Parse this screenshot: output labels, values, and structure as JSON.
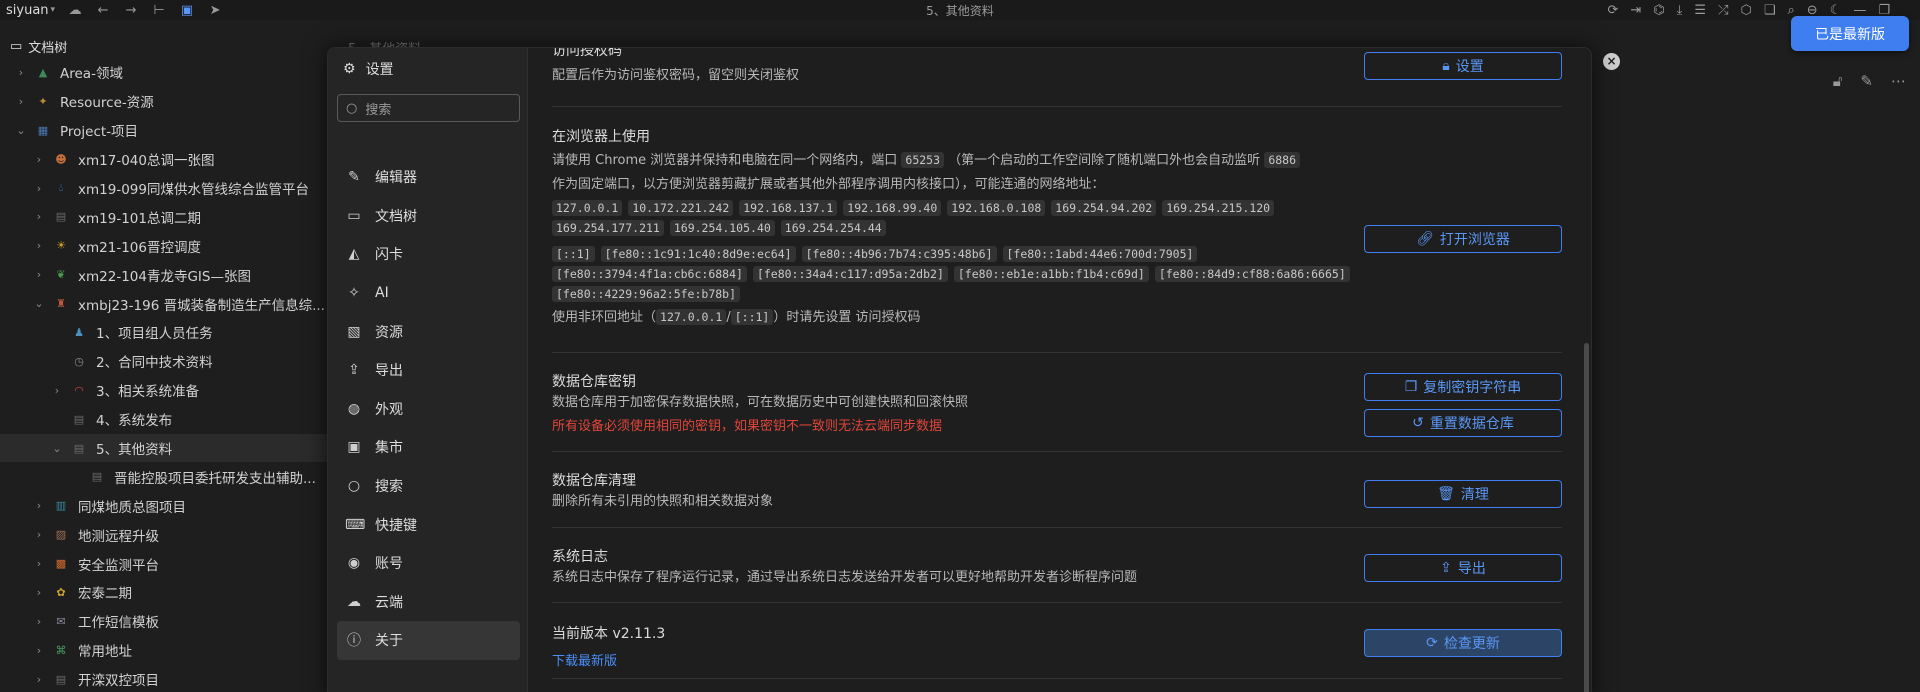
{
  "topbar": {
    "user": "siyuan",
    "title": "5、其他资料",
    "latest_button": "已是最新版"
  },
  "tree": {
    "title": "文档树",
    "items": [
      {
        "label": "Area-领域",
        "level": 0,
        "expand": "closed",
        "icon": "area-icon"
      },
      {
        "label": "Resource-资源",
        "level": 0,
        "expand": "closed",
        "icon": "resource-icon"
      },
      {
        "label": "Project-项目",
        "level": 0,
        "expand": "open",
        "icon": "calendar-icon"
      },
      {
        "label": "xm17-040总调一张图",
        "level": 1,
        "expand": "closed",
        "icon": "face-icon"
      },
      {
        "label": "xm19-099同煤供水管线综合监管平台",
        "level": 1,
        "expand": "closed",
        "icon": "water-icon"
      },
      {
        "label": "xm19-101总调二期",
        "level": 1,
        "expand": "closed",
        "icon": "doc-icon"
      },
      {
        "label": "xm21-106晋控调度",
        "level": 1,
        "expand": "closed",
        "icon": "sun-face-icon"
      },
      {
        "label": "xm22-104青龙寺GIS—张图",
        "level": 1,
        "expand": "closed",
        "icon": "dragon-icon"
      },
      {
        "label": "xmbj23-196 晋城装备制造生产信息综...",
        "level": 1,
        "expand": "open",
        "icon": "tower-icon"
      },
      {
        "label": "1、项目组人员任务",
        "level": 2,
        "expand": "none",
        "icon": "team-icon"
      },
      {
        "label": "2、合同中技术资料",
        "level": 2,
        "expand": "none",
        "icon": "clock-icon"
      },
      {
        "label": "3、相关系统准备",
        "level": 2,
        "expand": "closed",
        "icon": "rainbow-icon"
      },
      {
        "label": "4、系统发布",
        "level": 2,
        "expand": "none",
        "icon": "doc-icon"
      },
      {
        "label": "5、其他资料",
        "level": 2,
        "expand": "open",
        "icon": "doc-icon",
        "selected": true
      },
      {
        "label": "晋能控股项目委托研发支出辅助...",
        "level": 3,
        "expand": "none",
        "icon": "doc-icon"
      },
      {
        "label": "同煤地质总图项目",
        "level": 1,
        "expand": "closed",
        "icon": "book-icon"
      },
      {
        "label": "地测远程升级",
        "level": 1,
        "expand": "closed",
        "icon": "box-icon"
      },
      {
        "label": "安全监测平台",
        "level": 1,
        "expand": "closed",
        "icon": "vest-icon"
      },
      {
        "label": "宏泰二期",
        "level": 1,
        "expand": "closed",
        "icon": "flower-icon"
      },
      {
        "label": "工作短信模板",
        "level": 1,
        "expand": "closed",
        "icon": "mail-icon"
      },
      {
        "label": "常用地址",
        "level": 1,
        "expand": "closed",
        "icon": "map-icon"
      },
      {
        "label": "开滦双控项目",
        "level": 1,
        "expand": "closed",
        "icon": "doc-icon"
      }
    ]
  },
  "editor": {
    "tab_label": "5、其他资料"
  },
  "settings": {
    "title": "设置",
    "search_placeholder": "搜索",
    "nav": [
      {
        "label": "编辑器",
        "icon": "edit-icon"
      },
      {
        "label": "文档树",
        "icon": "folder-icon"
      },
      {
        "label": "闪卡",
        "icon": "flashcard-icon"
      },
      {
        "label": "AI",
        "icon": "ai-icon"
      },
      {
        "label": "资源",
        "icon": "image-icon"
      },
      {
        "label": "导出",
        "icon": "upload-icon"
      },
      {
        "label": "外观",
        "icon": "palette-icon"
      },
      {
        "label": "集市",
        "icon": "bazaar-icon"
      },
      {
        "label": "搜索",
        "icon": "search-icon"
      },
      {
        "label": "快捷键",
        "icon": "keyboard-icon"
      },
      {
        "label": "账号",
        "icon": "account-icon"
      },
      {
        "label": "云端",
        "icon": "cloud-icon"
      },
      {
        "label": "关于",
        "icon": "info-icon",
        "active": true
      }
    ],
    "sections": {
      "auth": {
        "title": "访问授权码",
        "desc": "配置后作为访问鉴权密码，留空则关闭鉴权",
        "button": "设置"
      },
      "browser": {
        "title": "在浏览器上使用",
        "desc1a": "请使用 Chrome 浏览器并保持和电脑在同一个网络内，端口",
        "port": "65253",
        "desc1b": "（第一个启动的工作空间除了随机端口外也会自动监听",
        "fixed_port": "6886",
        "desc2": "作为固定端口，以方便浏览器剪藏扩展或者其他外部程序调用内核接口），可能连通的网络地址：",
        "ipv4": [
          "127.0.0.1",
          "10.172.221.242",
          "192.168.137.1",
          "192.168.99.40",
          "192.168.0.108",
          "169.254.94.202",
          "169.254.215.120",
          "169.254.177.211",
          "169.254.105.40",
          "169.254.254.44"
        ],
        "ipv6": [
          "[::1]",
          "[fe80::1c91:1c40:8d9e:ec64]",
          "[fe80::4b96:7b74:c395:48b6]",
          "[fe80::1abd:44e6:700d:7905]",
          "[fe80::3794:4f1a:cb6c:6884]",
          "[fe80::34a4:c117:d95a:2db2]",
          "[fe80::eb1e:a1bb:f1b4:c69d]",
          "[fe80::84d9:cf88:6a86:6665]",
          "[fe80::4229:96a2:5fe:b78b]"
        ],
        "note_a": "使用非环回地址（",
        "loopback1": "127.0.0.1",
        "slash": "/",
        "loopback2": "[::1]",
        "note_b": "）时请先设置 访问授权码",
        "button": "打开浏览器"
      },
      "repo_key": {
        "title": "数据仓库密钥",
        "desc": "数据仓库用于加密保存数据快照，可在数据历史中可创建快照和回滚快照",
        "warning": "所有设备必须使用相同的密钥，如果密钥不一致则无法云端同步数据",
        "button_copy": "复制密钥字符串",
        "button_reset": "重置数据仓库"
      },
      "repo_clean": {
        "title": "数据仓库清理",
        "desc": "删除所有未引用的快照和相关数据对象",
        "button": "清理"
      },
      "logs": {
        "title": "系统日志",
        "desc": "系统日志中保存了程序运行记录，通过导出系统日志发送给开发者可以更好地帮助开发者诊断程序问题",
        "button": "导出"
      },
      "version": {
        "title": "当前版本 v2.11.3",
        "link": "下载最新版",
        "button": "检查更新"
      }
    }
  },
  "colors": {
    "accent": "#3f7ef0",
    "warning": "#e0453a",
    "background": "#1e1e1e",
    "sidebar": "#252525"
  }
}
